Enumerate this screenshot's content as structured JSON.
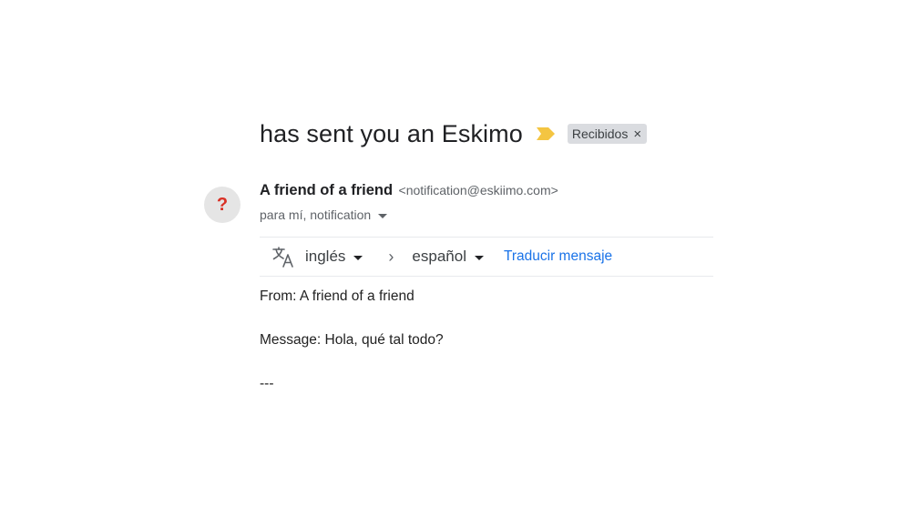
{
  "email": {
    "subject": "has sent you an Eskimo",
    "importance_icon": "importance-marker-icon",
    "importance_color": "#f4c542",
    "label": "Recibidos",
    "label_remove": "×",
    "sender": {
      "avatar_icon": "question-mark-icon",
      "avatar_glyph": "?",
      "name": "A friend of a friend",
      "email": "<notification@eskiimo.com>"
    },
    "recipients": "para mí, notification"
  },
  "translate": {
    "icon": "translate-icon",
    "from_language": "inglés",
    "to_language": "español",
    "action": "Traducir mensaje"
  },
  "body": {
    "line1": "From: A friend of a friend",
    "line2": "Message: Hola, qué tal todo?",
    "line3": "---"
  },
  "colors": {
    "link": "#1a73e8",
    "avatar_mark": "#d93025"
  }
}
